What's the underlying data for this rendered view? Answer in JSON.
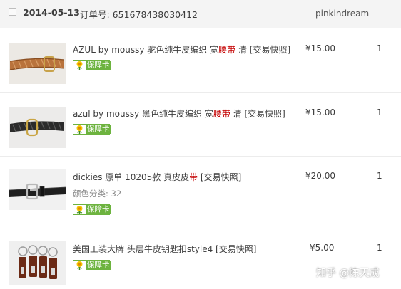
{
  "order": {
    "date": "2014-05-13",
    "order_number_label": "订单号: 651678438030412",
    "seller": "pinkindream"
  },
  "items": [
    {
      "title_before": "AZUL by moussy 驼色纯牛皮编织 宽",
      "title_highlight": "腰带",
      "title_after": " 清 [交易快照]",
      "badge": "保障卡",
      "spec": "",
      "price": "¥15.00",
      "qty": "1",
      "thumb_icon": "tan-woven-belt-image"
    },
    {
      "title_before": "azul by moussy 黑色纯牛皮编织 宽",
      "title_highlight": "腰带",
      "title_after": " 清 [交易快照]",
      "badge": "保障卡",
      "spec": "",
      "price": "¥15.00",
      "qty": "1",
      "thumb_icon": "black-woven-belt-image"
    },
    {
      "title_before": "dickies 原单 10205款 真皮皮",
      "title_highlight": "带",
      "title_after": " [交易快照]",
      "badge": "保障卡",
      "spec": "颜色分类: 32",
      "price": "¥20.00",
      "qty": "1",
      "thumb_icon": "black-leather-belt-image"
    },
    {
      "title_before": "美国工装大牌 头层牛皮钥匙扣style4 [交易快照]",
      "title_highlight": "",
      "title_after": "",
      "badge": "保障卡",
      "spec": "",
      "price": "¥5.00",
      "qty": "1",
      "thumb_icon": "leather-keychains-image"
    }
  ],
  "watermark": "知乎 @陈天成",
  "colors": {
    "highlight": "#c40000",
    "badge_green": "#6db33f",
    "header_bg": "#f4f4f4"
  }
}
